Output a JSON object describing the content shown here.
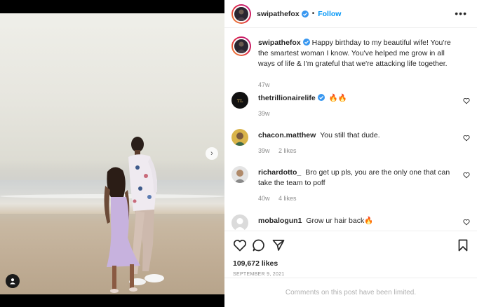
{
  "post": {
    "author": "swipathefox",
    "follow_label": "Follow",
    "more_label": "•••",
    "caption": "Happy birthday to my beautiful wife! You're the smartest woman I know. You've helped me grow in all ways of life & I'm grateful that we're attacking life together.",
    "caption_time": "47w",
    "likes": "109,672 likes",
    "date": "SEPTEMBER 9, 2021",
    "comments_limited": "Comments on this post have been limited."
  },
  "comments": [
    {
      "user": "thetrillionairelife",
      "verified": true,
      "text": "🔥🔥",
      "time": "39w",
      "likes": ""
    },
    {
      "user": "chacon.matthew",
      "verified": false,
      "text": "You still that dude.",
      "time": "39w",
      "likes": "2 likes"
    },
    {
      "user": "richardotto_",
      "verified": false,
      "text": "Bro get up pls, you are the only one that can take the team to poff",
      "time": "40w",
      "likes": "4 likes"
    },
    {
      "user": "mobalogun1",
      "verified": false,
      "text": "Grow ur hair back🔥",
      "time": "",
      "likes": ""
    }
  ],
  "icons": {
    "verified": "verified-badge-icon",
    "like": "heart-icon",
    "comment": "comment-icon",
    "share": "paper-plane-icon",
    "save": "bookmark-icon",
    "next": "chevron-right-icon",
    "tag": "user-tag-icon"
  },
  "colors": {
    "accent": "#0095f6",
    "text": "#262626",
    "muted": "#8e8e8e"
  }
}
